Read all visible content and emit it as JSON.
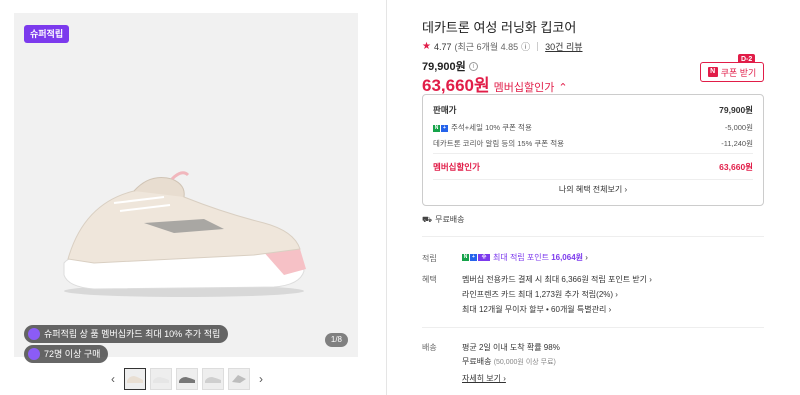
{
  "gallery": {
    "tag": "슈퍼적립",
    "promo1": "슈퍼적립 상 품 멤버십카드 최대 10% 추가 적립",
    "promo2": "72명 이상 구매",
    "page_count": "1/8",
    "prev_arrow": "‹",
    "next_arrow": "›"
  },
  "product": {
    "title": "데카트론 여성 러닝화 킵코어",
    "rating": "4.77",
    "rating_sub": "(최근 6개월 4.85",
    "review_count": "30건 리뷰",
    "original_price": "79,900원",
    "sale_price": "63,660원",
    "sale_label": "멤버십할인가",
    "coupon_button": "쿠폰 받기",
    "coupon_badge": "D-2"
  },
  "price_box": {
    "head_label": "판매가",
    "head_value": "79,900원",
    "row1_label": "주석+세일 10% 쿠폰 적용",
    "row1_value": "-5,000원",
    "row2_label": "데카트론 코리아 알림 등의 15% 쿠폰 적용",
    "row2_value": "-11,240원",
    "total_label": "멤버십할인가",
    "total_value": "63,660원",
    "all_benefits": "나의 혜택 전체보기"
  },
  "shipping_free": "무료배송",
  "sections": {
    "points_label": "적립",
    "points_value_prefix": "최대 적립 포인트 ",
    "points_value": "16,064원",
    "benefits_label": "혜택",
    "benefit1": "멤버십 전용카드 결제 시 최대 6,366원 적립 포인트 받기",
    "benefit2": "라인프렌즈 카드 최대 1,273원 추가 적립(2%)",
    "benefit3": "최대 12개월 무이자 할부 • 60개월 특별관리",
    "shipping_label": "배송",
    "shipping1": "평균 2일 이내 도착 확률 98%",
    "shipping2": "무료배송",
    "shipping2_sub": "(50,000원 이상 무료)",
    "details_link": "자세히 보기"
  },
  "colors": {
    "accent": "#e11d48",
    "purple": "#7c3aed"
  }
}
